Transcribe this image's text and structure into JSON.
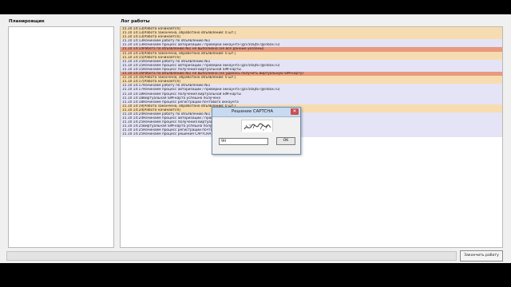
{
  "app": {
    "planning_title": "Планировщик",
    "log_title": "Лог работы",
    "finish_button": "Закончить работу"
  },
  "log": [
    {
      "time": "15.10 14:13",
      "text": "[Работа начинается]",
      "color": "#f6dcb0"
    },
    {
      "time": "15.10 14:13",
      "text": "[Работа закончена, обработано объявлений: 0 шт.]",
      "color": "#f6dcb0"
    },
    {
      "time": "15.10 14:13",
      "text": "[Работа начинается]",
      "color": "#f6dcb0"
    },
    {
      "time": "15.10 14:13",
      "text": "Начинаем работу по объявлению №1",
      "color": "#e4e4f6"
    },
    {
      "time": "15.10 14:13",
      "text": "Начинаем процесс авторизации / проверки аккаунта (gcv50ajto7@inbox.ru)",
      "color": "#e4e4f6"
    },
    {
      "time": "15.10 14:14",
      "text": "Работа по объявлению №1 не выполнена (не все данные указаны)",
      "color": "#e79a7e"
    },
    {
      "time": "15.10 14:14",
      "text": "[Работа закончена, обработано объявлений: 0 шт.]",
      "color": "#f6dcb0"
    },
    {
      "time": "15.10 14:15",
      "text": "[Работа начинается]",
      "color": "#f6dcb0"
    },
    {
      "time": "15.10 14:15",
      "text": "Начинаем работу по объявлению №1",
      "color": "#e4e4f6"
    },
    {
      "time": "15.10 14:15",
      "text": "Начинаем процесс авторизации / проверки аккаунта (gcv50ajto7@inbox.ru)",
      "color": "#e4e4f6"
    },
    {
      "time": "15.10 14:15",
      "text": "Начинаем процесс получения виртуальной SIM-карты",
      "color": "#e4e4f6"
    },
    {
      "time": "15.10 14:16",
      "text": "Работа по объявлению №1 не выполнена (не удалось получить виртуальную SIM-карту)",
      "color": "#e79a7e"
    },
    {
      "time": "15.10 14:16",
      "text": "[Работа закончена, обработано объявлений: 0 шт.]",
      "color": "#f6dcb0"
    },
    {
      "time": "15.10 14:17",
      "text": "[Работа начинается]",
      "color": "#f6dcb0"
    },
    {
      "time": "15.10 14:17",
      "text": "Начинаем работу по объявлению №1",
      "color": "#e4e4f6"
    },
    {
      "time": "15.10 14:17",
      "text": "Начинаем процесс авторизации / проверки аккаунта (gcv50ajto7@inbox.ru)",
      "color": "#e4e4f6"
    },
    {
      "time": "15.10 14:18",
      "text": "Начинаем процесс получения виртуальной SIM-карты",
      "color": "#e4e4f6"
    },
    {
      "time": "15.10 14:18",
      "text": "Виртуальная SIM-карта успешно получена",
      "color": "#e4e4f6"
    },
    {
      "time": "15.10 14:18",
      "text": "Начинаем процесс регистрации почтового аккаунта",
      "color": "#e4e4f6"
    },
    {
      "time": "15.10 14:19",
      "text": "[Работа закончена, обработано объявлений: 0 шт.]",
      "color": "#f6dcb0"
    },
    {
      "time": "15.10 14:24",
      "text": "[Работа начинается]",
      "color": "#f6dcb0"
    },
    {
      "time": "15.10 14:24",
      "text": "Начинаем работу по объявлению №1",
      "color": "#e4e4f6"
    },
    {
      "time": "15.10 14:24",
      "text": "Начинаем процесс авторизации / проверки аккаунта",
      "color": "#e4e4f6"
    },
    {
      "time": "15.10 14:25",
      "text": "Начинаем процесс получения виртуальной SIM-карты",
      "color": "#e4e4f6"
    },
    {
      "time": "15.10 14:25",
      "text": "Виртуальная SIM-карта успешно получена",
      "color": "#e4e4f6"
    },
    {
      "time": "15.10 14:25",
      "text": "Начинаем процесс регистрации почтового аккаунта",
      "color": "#e4e4f6"
    },
    {
      "time": "15.10 14:25",
      "text": "Начинаем процесс решения CAPTCHA",
      "color": "#e4e4f6"
    }
  ],
  "dialog": {
    "title": "Решение CAPTCHA",
    "close_glyph": "✕",
    "input_value": "9H",
    "ok_label": "OK",
    "captcha_text": "xvcs"
  }
}
